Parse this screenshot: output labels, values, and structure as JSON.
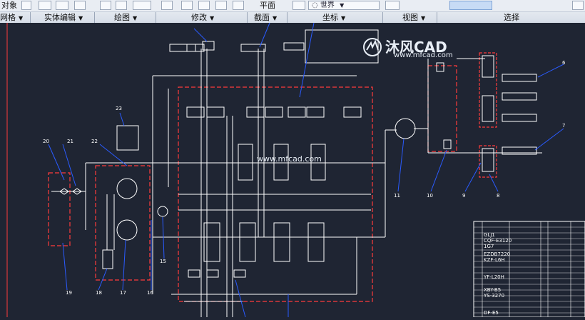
{
  "ribbon": {
    "row1": {
      "object_label": "对象",
      "plane_label": "平面",
      "ucs_value": "世界"
    },
    "panels": {
      "mesh": "网格",
      "solid_edit": "实体编辑",
      "draw": "绘图",
      "modify": "修改",
      "section": "截面",
      "coordinates": "坐标",
      "view": "视图",
      "select": "选择"
    }
  },
  "watermark": {
    "brand": "沐风CAD",
    "url": "www.mfcad.com",
    "center_url": "www.mfcad.com"
  },
  "callouts": [
    "23",
    "22",
    "21",
    "20",
    "19",
    "18",
    "17",
    "16",
    "15",
    "11",
    "10",
    "9",
    "8",
    "7",
    "6"
  ],
  "parts_table": {
    "codes": [
      "GLJ1",
      "CQF-E3120",
      "1G7",
      "EZDB7220",
      "KZF-L6H",
      "YF-L20H",
      "XBY-B5",
      "YS-3270",
      "DF-E5"
    ]
  },
  "colors": {
    "canvas_bg": "#1f2533",
    "line": "#ffffff",
    "dashed_boundary": "#ff3b3b",
    "leader": "#2a5bff",
    "ribbon_bg": "#e9edf3"
  }
}
